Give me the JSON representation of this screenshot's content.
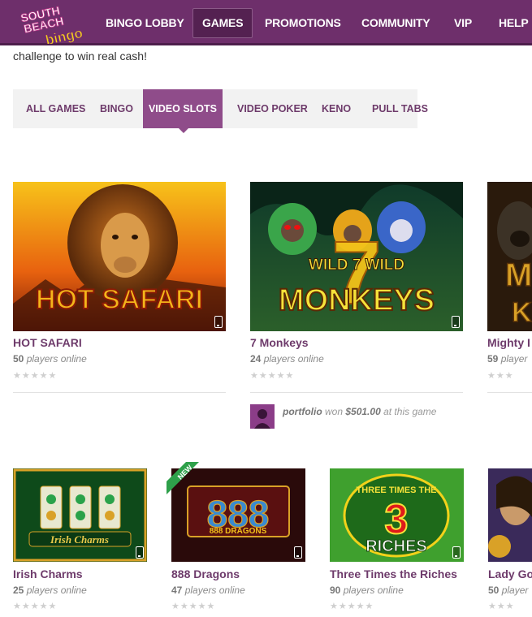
{
  "header": {
    "logo_text": "SOUTH BEACH bingo",
    "nav": [
      {
        "label": "BINGO LOBBY"
      },
      {
        "label": "GAMES"
      },
      {
        "label": "PROMOTIONS"
      },
      {
        "label": "COMMUNITY"
      },
      {
        "label": "VIP"
      },
      {
        "label": "HELP"
      }
    ]
  },
  "intro_text": "challenge to win real cash!",
  "tabs": [
    {
      "label": "ALL GAMES"
    },
    {
      "label": "BINGO"
    },
    {
      "label": "VIDEO SLOTS"
    },
    {
      "label": "VIDEO POKER"
    },
    {
      "label": "KENO"
    },
    {
      "label": "PULL TABS"
    }
  ],
  "active_tab": "VIDEO SLOTS",
  "games_row1": [
    {
      "title": "HOT SAFARI",
      "players": "50",
      "players_suffix": "players online",
      "rating": "★★★★★",
      "thumb_text": "HOT SAFARI"
    },
    {
      "title": "7 Monkeys",
      "players": "24",
      "players_suffix": "players online",
      "rating": "★★★★★",
      "thumb_text_top": "WILD 7 WILD",
      "thumb_text": "MONKEYS"
    },
    {
      "title": "Mighty I",
      "players": "59",
      "players_suffix": "player",
      "rating": "★★★"
    }
  ],
  "winner": {
    "user": "portfolio",
    "won": "won",
    "amount": "$501.00",
    "suffix": "at this game"
  },
  "games_row2": [
    {
      "title": "Irish Charms",
      "players": "25",
      "players_suffix": "players online",
      "rating": "★★★★★",
      "thumb_text": "Irish Charms"
    },
    {
      "title": "888 Dragons",
      "players": "47",
      "players_suffix": "players online",
      "rating": "★★★★★",
      "thumb_text": "888 DRAGONS",
      "badge": "NEW"
    },
    {
      "title": "Three Times the Riches",
      "players": "90",
      "players_suffix": "players online",
      "rating": "★★★★★",
      "thumb_text_top": "THREE TIMES THE",
      "thumb_text": "RICHES",
      "thumb_number": "3"
    },
    {
      "title": "Lady Go",
      "players": "50",
      "players_suffix": "player",
      "rating": "★★★"
    }
  ],
  "colors": {
    "brand_purple": "#6e2f6b",
    "tab_active": "#8f4c8a",
    "title_purple": "#6e3b6b"
  }
}
